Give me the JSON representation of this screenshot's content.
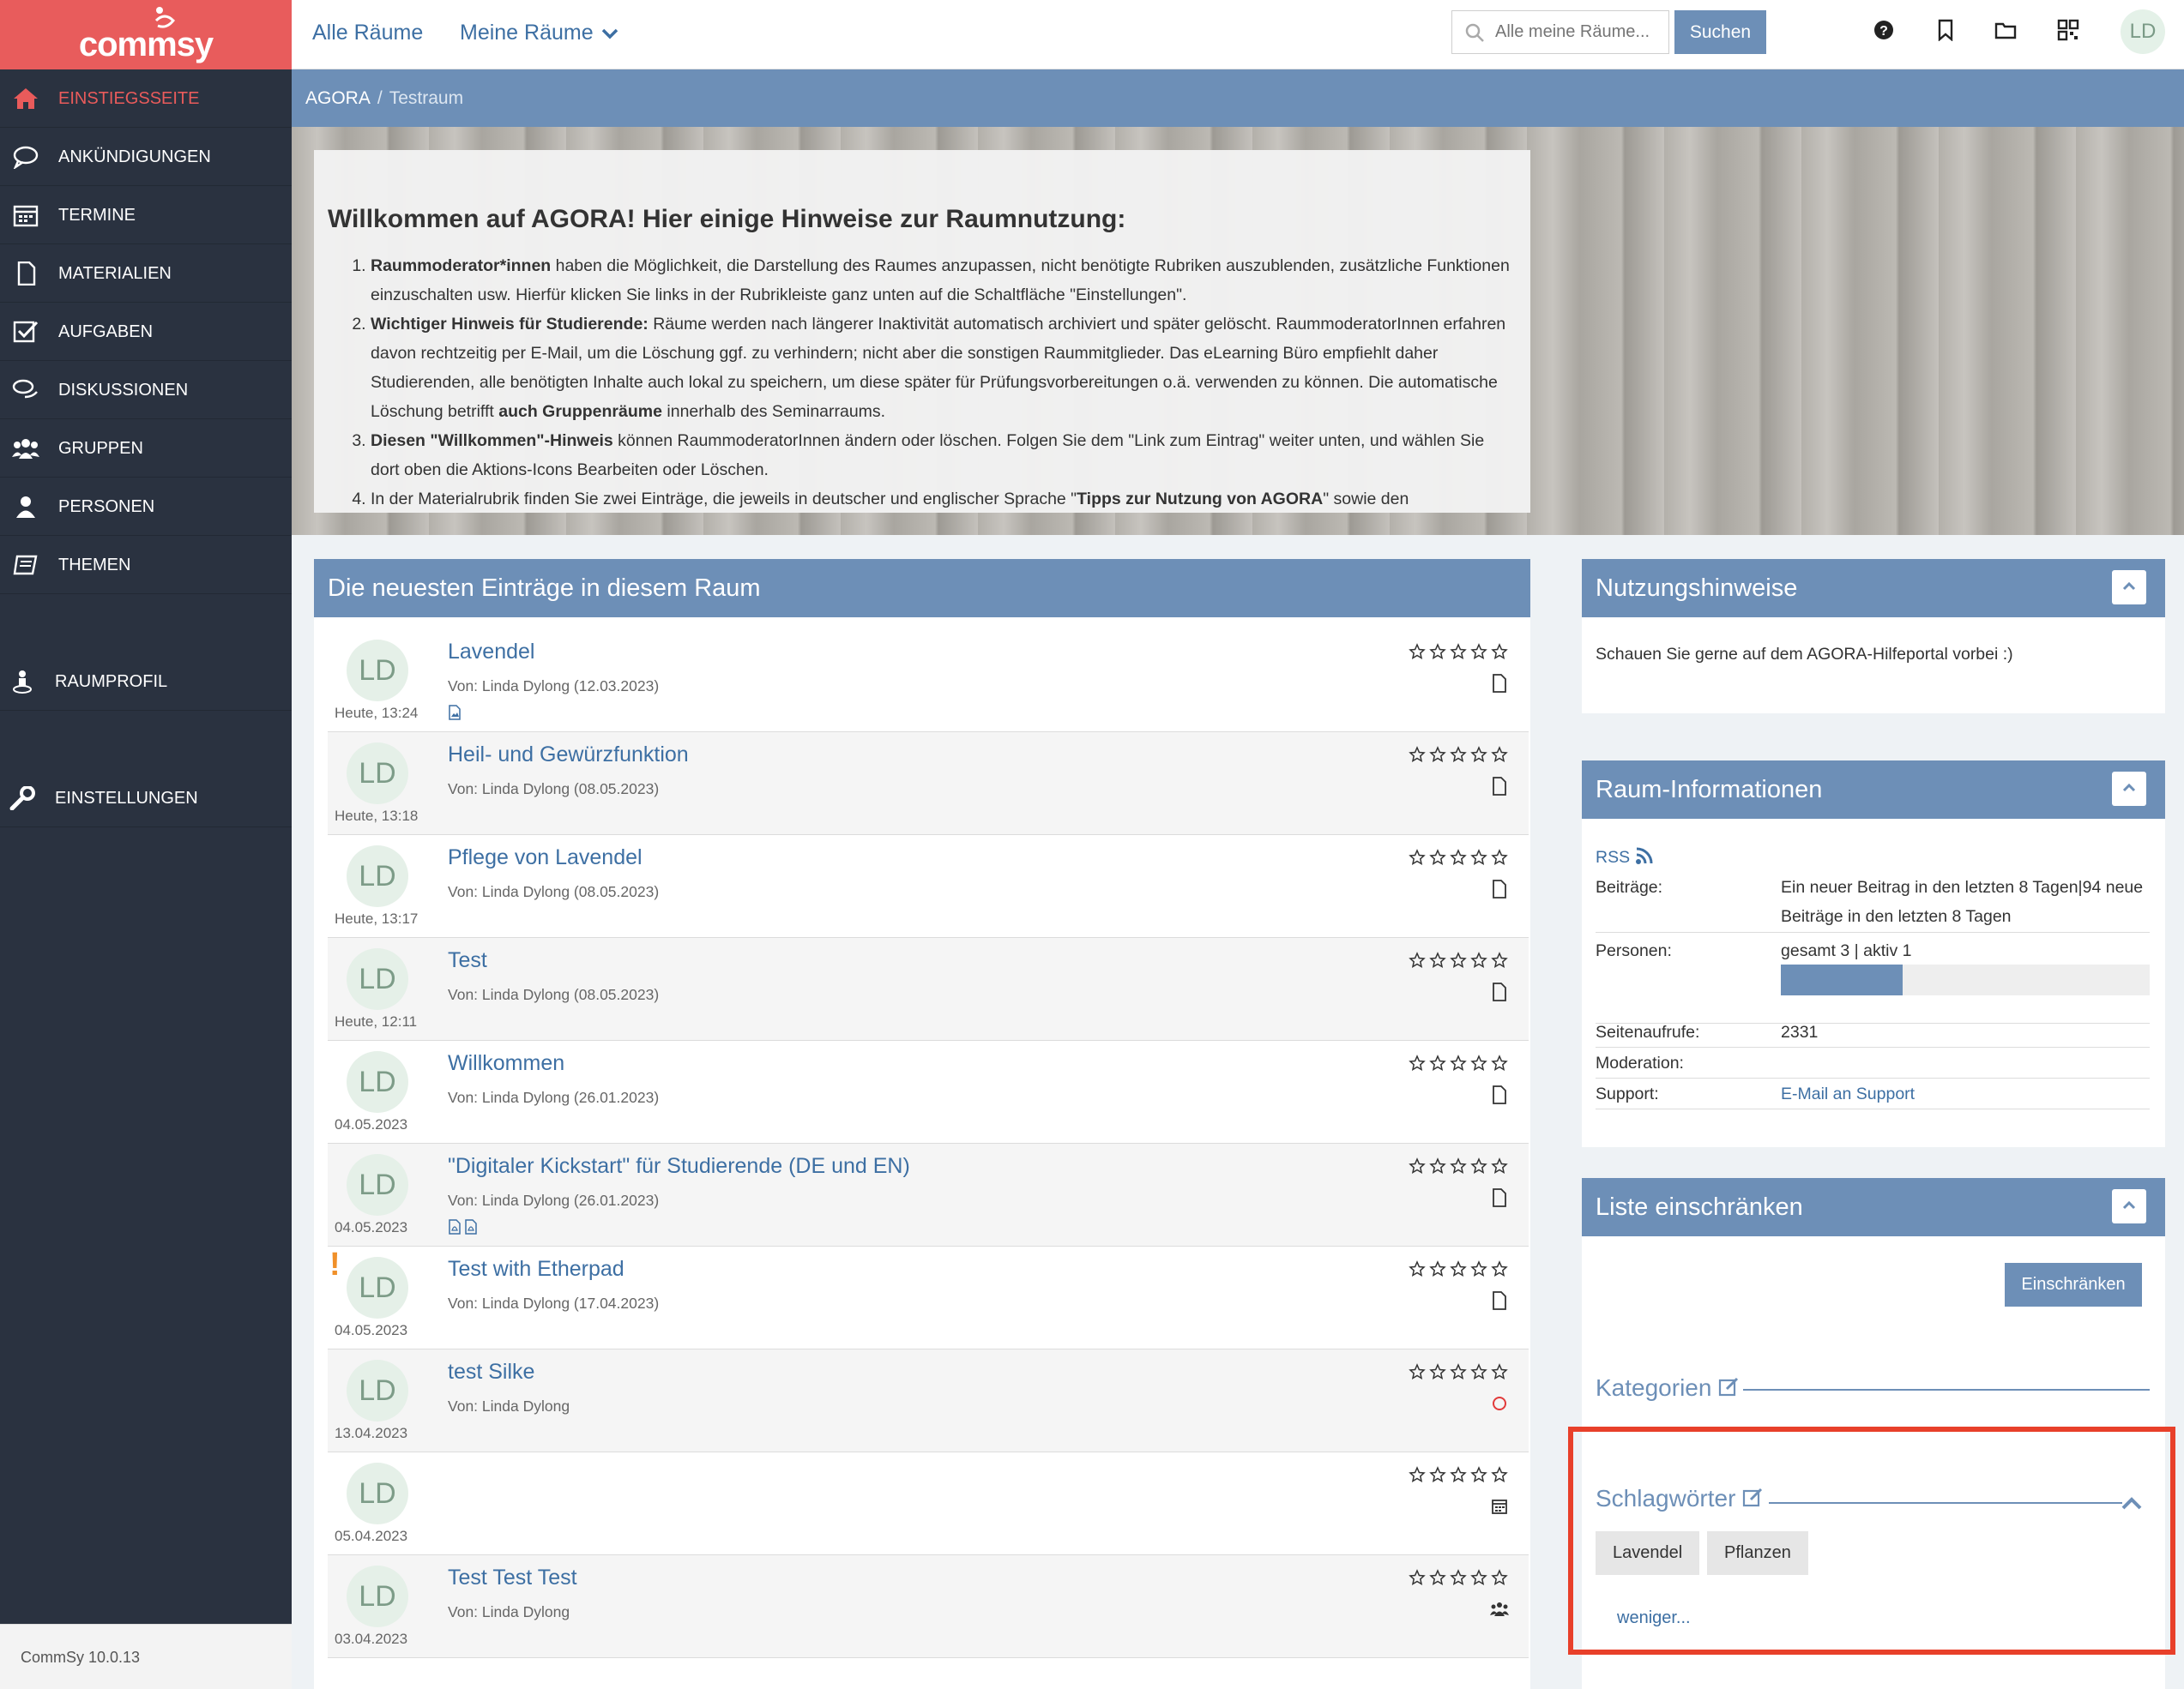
{
  "app": {
    "logo_text": "commsy",
    "version": "CommSy 10.0.13"
  },
  "colors": {
    "accent_red": "#e85c5c",
    "header_blue": "#6d8fb7",
    "link_blue": "#3d6fa3",
    "sidebar_bg": "#2a3240",
    "warning_orange": "#f0902a",
    "highlight_frame": "#e8402a"
  },
  "sidebar": {
    "items": [
      {
        "label": "Einstiegsseite",
        "icon": "home-icon",
        "active": true
      },
      {
        "label": "Ankündigungen",
        "icon": "speech-bubble-icon"
      },
      {
        "label": "Termine",
        "icon": "calendar-icon"
      },
      {
        "label": "Materialien",
        "icon": "document-icon"
      },
      {
        "label": "Aufgaben",
        "icon": "checkbox-icon"
      },
      {
        "label": "Diskussionen",
        "icon": "discussion-icon"
      },
      {
        "label": "Gruppen",
        "icon": "group-icon"
      },
      {
        "label": "Personen",
        "icon": "person-icon"
      },
      {
        "label": "Themen",
        "icon": "book-icon"
      },
      {
        "label": "Raumprofil",
        "icon": "profile-icon"
      },
      {
        "label": "Einstellungen",
        "icon": "wrench-icon"
      }
    ]
  },
  "topbar": {
    "all_rooms": "Alle Räume",
    "my_rooms": "Meine Räume",
    "search_placeholder": "Alle meine Räume...",
    "search_button": "Suchen",
    "icons": [
      "help-icon",
      "bookmark-icon",
      "folder-icon",
      "qr-code-icon"
    ],
    "avatar": "LD"
  },
  "breadcrumb": {
    "portal": "AGORA",
    "separator": "/",
    "room": "Testraum"
  },
  "welcome": {
    "title": "Willkommen auf AGORA! Hier einige Hinweise zur Raumnutzung:",
    "items": [
      {
        "bold": "Raummoderator*innen",
        "text": " haben die Möglichkeit, die Darstellung des Raumes anzupassen, nicht benötigte Rubriken auszublenden, zusätzliche Funktionen einzuschalten usw. Hierfür klicken Sie links in der Rubrikleiste ganz unten auf die Schaltfläche \"Einstellungen\"."
      },
      {
        "bold": "Wichtiger Hinweis für Studierende:",
        "text": " Räume werden nach längerer Inaktivität automatisch archiviert und später gelöscht. RaummoderatorInnen erfahren davon rechtzeitig per E-Mail, um die Löschung ggf. zu verhindern; nicht aber die sonstigen Raummitglieder. Das eLearning Büro empfiehlt daher Studierenden, alle benötigten Inhalte auch lokal zu speichern, um diese später für Prüfungsvorbereitungen o.ä. verwenden zu können. Die automatische Löschung betrifft ",
        "bold2": "auch Gruppenräume",
        "text2": " innerhalb des Seminarraums."
      },
      {
        "bold": "Diesen \"Willkommen\"-Hinweis",
        "text": " können RaummoderatorInnen ändern oder löschen. Folgen Sie dem \"Link zum Eintrag\" weiter unten, und wählen Sie dort oben die Aktions-Icons Bearbeiten oder Löschen."
      },
      {
        "text": "In der Materialrubrik finden Sie zwei Einträge, die jeweils in deutscher und englischer Sprache \"",
        "bold2": "Tipps zur Nutzung von AGORA",
        "text2": "\" sowie den"
      }
    ]
  },
  "feed": {
    "title": "Die neuesten Einträge in diesem Raum",
    "entries": [
      {
        "avatar": "LD",
        "date": "Heute, 13:24",
        "title": "Lavendel",
        "meta": "Von: Linda Dylong (12.03.2023)",
        "type_icon": "document-icon",
        "files": [
          "image-file-icon"
        ],
        "rating": 0
      },
      {
        "avatar": "LD",
        "date": "Heute, 13:18",
        "title": "Heil- und Gewürzfunktion",
        "meta": "Von: Linda Dylong (08.05.2023)",
        "type_icon": "document-icon",
        "rating": 0
      },
      {
        "avatar": "LD",
        "date": "Heute, 13:17",
        "title": "Pflege von Lavendel",
        "meta": "Von: Linda Dylong (08.05.2023)",
        "type_icon": "document-icon",
        "rating": 0
      },
      {
        "avatar": "LD",
        "date": "Heute, 12:11",
        "title": "Test",
        "meta": "Von: Linda Dylong (08.05.2023)",
        "type_icon": "document-icon",
        "rating": 0
      },
      {
        "avatar": "LD",
        "date": "04.05.2023",
        "title": "Willkommen",
        "meta": "Von: Linda Dylong (26.01.2023)",
        "type_icon": "document-icon",
        "rating": 0
      },
      {
        "avatar": "LD",
        "date": "04.05.2023",
        "title": "\"Digitaler Kickstart\" für Studierende (DE und EN)",
        "meta": "Von: Linda Dylong (26.01.2023)",
        "type_icon": "document-icon",
        "files": [
          "pdf-file-icon",
          "pdf-file-icon"
        ],
        "rating": 0
      },
      {
        "avatar": "LD",
        "date": "04.05.2023",
        "title": "Test with Etherpad",
        "meta": "Von: Linda Dylong (17.04.2023)",
        "type_icon": "document-icon",
        "warning": "!",
        "rating": 0
      },
      {
        "avatar": "LD",
        "date": "13.04.2023",
        "title": "test Silke",
        "meta": "Von: Linda Dylong",
        "type_icon": "todo-circle-icon",
        "rating": 0
      },
      {
        "avatar": "LD",
        "date": "05.04.2023",
        "title": "",
        "meta": "",
        "type_icon": "calendar-icon",
        "rating": 0
      },
      {
        "avatar": "LD",
        "date": "03.04.2023",
        "title": "Test Test Test",
        "meta": "Von: Linda Dylong",
        "type_icon": "group-icon",
        "rating": 0
      }
    ]
  },
  "usage": {
    "title": "Nutzungshinweise",
    "text": "Schauen Sie gerne auf dem AGORA-Hilfeportal vorbei :)"
  },
  "room_info": {
    "title": "Raum-Informationen",
    "rss": "RSS",
    "rows": [
      {
        "key": "Beiträge:",
        "lines": [
          "Ein neuer Beitrag in den letzten 8 Tagen|94 neue",
          "Beiträge in den letzten 8 Tagen"
        ]
      },
      {
        "key": "Personen:",
        "lines": [
          "gesamt 3 | aktiv 1"
        ]
      },
      {
        "key": "Seitenaufrufe:",
        "lines": [
          "2331"
        ]
      },
      {
        "key": "Moderation:",
        "lines": [
          ""
        ]
      },
      {
        "key": "Support:",
        "lines": [
          "E-Mail an Support"
        ]
      }
    ],
    "active_ratio": 0.33
  },
  "filter": {
    "title": "Liste einschränken",
    "apply_button": "Einschränken",
    "categories_label": "Kategorien",
    "tags_label": "Schlagwörter",
    "tags": [
      "Lavendel",
      "Pflanzen"
    ],
    "less_link": "weniger..."
  }
}
